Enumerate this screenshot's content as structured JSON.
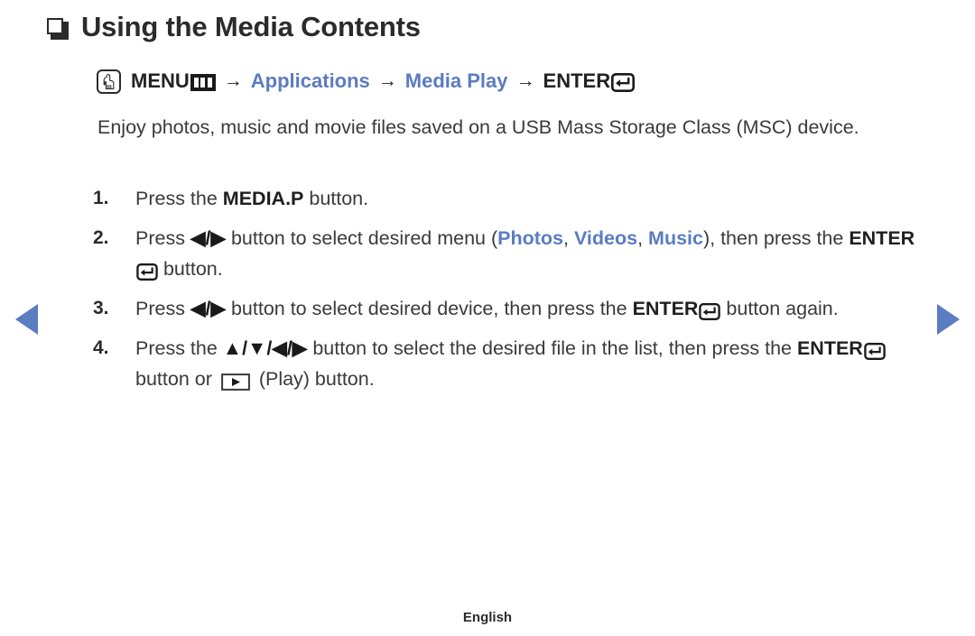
{
  "page": {
    "title": "Using the Media Contents",
    "bullet_icon": "square-bullet-icon",
    "footer_label": "English"
  },
  "colors": {
    "accent_blue": "#5b7cc2",
    "text": "#3a3a3a",
    "heading": "#2b2b2b"
  },
  "menu_path": {
    "hand_icon": "touch-hand-icon",
    "menu_label": "MENU",
    "menu_icon": "menu-bars-icon",
    "arrow": "→",
    "step1": "Applications",
    "step2": "Media Play",
    "enter_label": "ENTER",
    "enter_icon": "enter-return-icon"
  },
  "intro": "Enjoy photos, music and movie files saved on a USB Mass Storage Class (MSC) device.",
  "steps": [
    {
      "num": "1.",
      "part1": "Press the ",
      "bold1": "MEDIA.P",
      "part2": " button."
    },
    {
      "num": "2.",
      "part1": "Press ",
      "dirs": "◀/▶",
      "part2": " button to select desired menu (",
      "blue1": "Photos",
      "sep1": ", ",
      "blue2": "Videos",
      "sep2": ", ",
      "blue3": "Music",
      "part3": "), then press the ",
      "bold_enter": "ENTER",
      "part4": " button."
    },
    {
      "num": "3.",
      "part1": "Press ",
      "dirs": "◀/▶",
      "part2": " button to select desired device, then press the ",
      "bold_enter": "ENTER",
      "part3": " button again."
    },
    {
      "num": "4.",
      "part1": "Press the ",
      "dirs": "▲/▼/◀/▶",
      "part2": " button to select the desired file in the list, then press the ",
      "bold_enter": "ENTER",
      "part3": " button or ",
      "play_icon": "play-button-icon",
      "part4": " (Play) button."
    }
  ],
  "nav": {
    "prev_icon": "prev-page-arrow-icon",
    "next_icon": "next-page-arrow-icon"
  }
}
